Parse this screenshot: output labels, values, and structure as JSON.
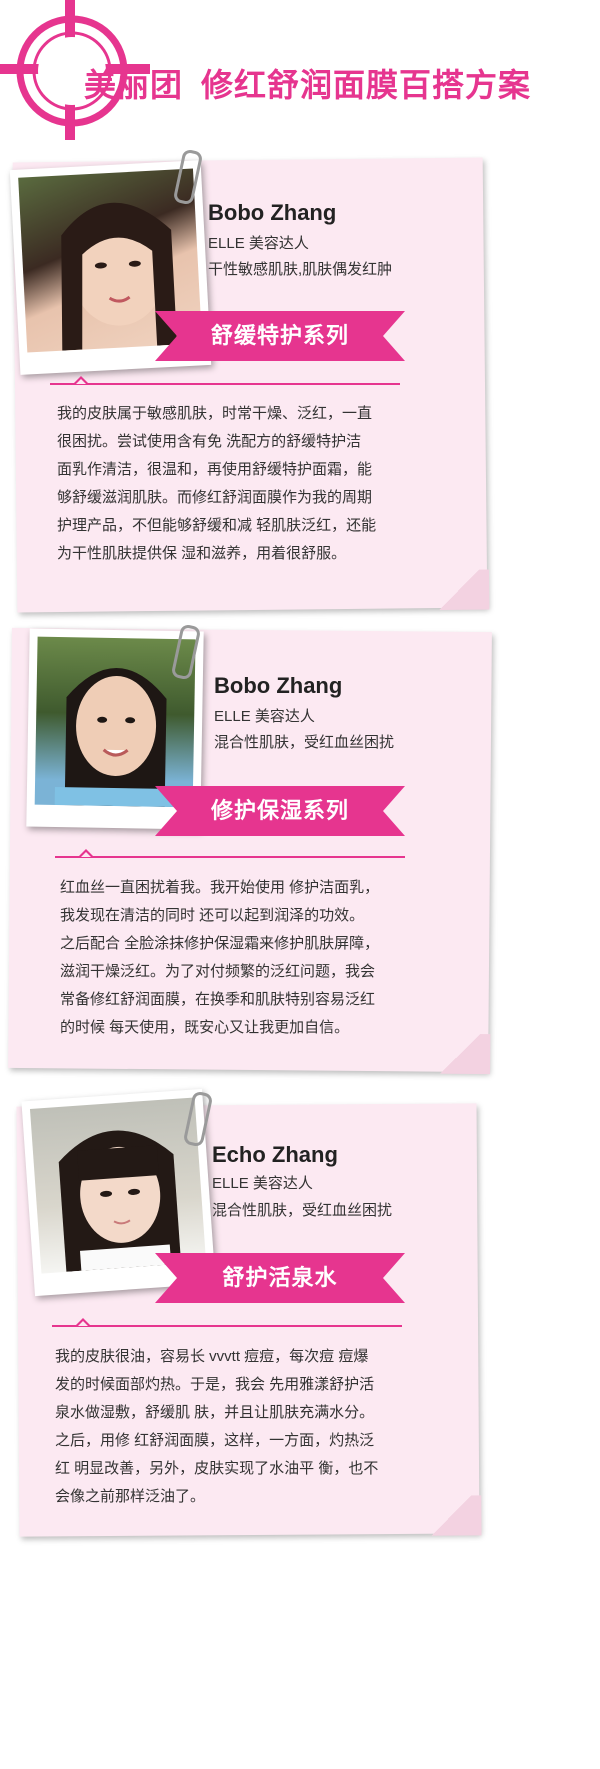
{
  "header": {
    "brand": "美丽团",
    "title": "修红舒润面膜百搭方案",
    "accent": "#e6358f"
  },
  "cards": [
    {
      "name": "Bobo Zhang",
      "role": "ELLE 美容达人",
      "skin": "干性敏感肌肤,肌肤偶发红肿",
      "series": "舒缓特护系列",
      "body": [
        "我的皮肤属于敏感肌肤，时常干燥、泛红，一直",
        "很困扰。尝试使用含有免 洗配方的舒缓特护洁",
        "面乳作清洁，很温和，再使用舒缓特护面霜，能",
        "够舒缓滋润肌肤。而修红舒润面膜作为我的周期",
        "护理产品，不但能够舒缓和减 轻肌肤泛红，还能",
        "为干性肌肤提供保 湿和滋养，用着很舒服。"
      ]
    },
    {
      "name": "Bobo Zhang",
      "role": "ELLE 美容达人",
      "skin": "混合性肌肤，受红血丝困扰",
      "series": "修护保湿系列",
      "body": [
        "红血丝一直困扰着我。我开始使用 修护洁面乳，",
        "我发现在清洁的同时 还可以起到润泽的功效。",
        "之后配合 全脸涂抹修护保湿霜来修护肌肤屏障，",
        "滋润干燥泛红。为了对付频繁的泛红问题，我会",
        "常备修红舒润面膜，在换季和肌肤特别容易泛红",
        "的时候 每天使用，既安心又让我更加自信。"
      ]
    },
    {
      "name": "Echo Zhang",
      "role": "ELLE 美容达人",
      "skin": "混合性肌肤，受红血丝困扰",
      "series": "舒护活泉水",
      "body": [
        "我的皮肤很油，容易长 vvvtt 痘痘，每次痘 痘爆",
        "发的时候面部灼热。于是，我会 先用雅漾舒护活",
        "泉水做湿敷，舒缓肌 肤，并且让肌肤充满水分。",
        "之后，用修 红舒润面膜，这样，一方面，灼热泛",
        "红 明显改善，另外，皮肤实现了水油平 衡，也不",
        "会像之前那样泛油了。"
      ]
    }
  ]
}
